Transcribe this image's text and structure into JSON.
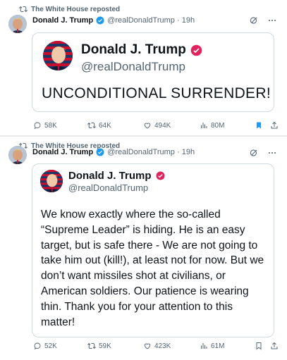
{
  "posts": [
    {
      "repost_label": "The White House reposted",
      "author_name": "Donald J. Trump",
      "author_meta": "@realDonaldTrump · 19h",
      "quote": {
        "name": "Donald J. Trump",
        "handle": "@realDonaldTrump",
        "text": "UNCONDITIONAL SURRENDER!"
      },
      "stats": {
        "replies": "58K",
        "reposts": "64K",
        "likes": "494K",
        "views": "80M"
      },
      "bookmarked": true
    },
    {
      "repost_label": "The White House reposted",
      "author_name": "Donald J. Trump",
      "author_meta": "@realDonaldTrump · 19h",
      "quote": {
        "name": "Donald J. Trump",
        "handle": "@realDonaldTrump",
        "text": "We know exactly where the so-called “Supreme Leader” is hiding. He is an easy target, but is safe there - We are not going to take him out (kill!), at least not for now. But we don’t want missiles shot at civilians, or American soldiers. Our patience is wearing thin. Thank you for your attention to this matter!"
      },
      "stats": {
        "replies": "52K",
        "reposts": "59K",
        "likes": "423K",
        "views": "61M"
      },
      "bookmarked": false
    }
  ],
  "icons": {
    "repost": "repost-icon",
    "verified": "verified-badge-icon",
    "grok": "grok-icon",
    "more": "more-icon",
    "reply": "reply-icon",
    "like": "heart-icon",
    "views": "views-icon",
    "bookmark": "bookmark-icon",
    "share": "share-icon"
  },
  "colors": {
    "text": "#0f1419",
    "muted": "#536471",
    "verified_blue": "#1d9bf0",
    "verified_pink": "#e0245e",
    "bookmark_active": "#1d9bf0",
    "border": "#cfd9de"
  }
}
